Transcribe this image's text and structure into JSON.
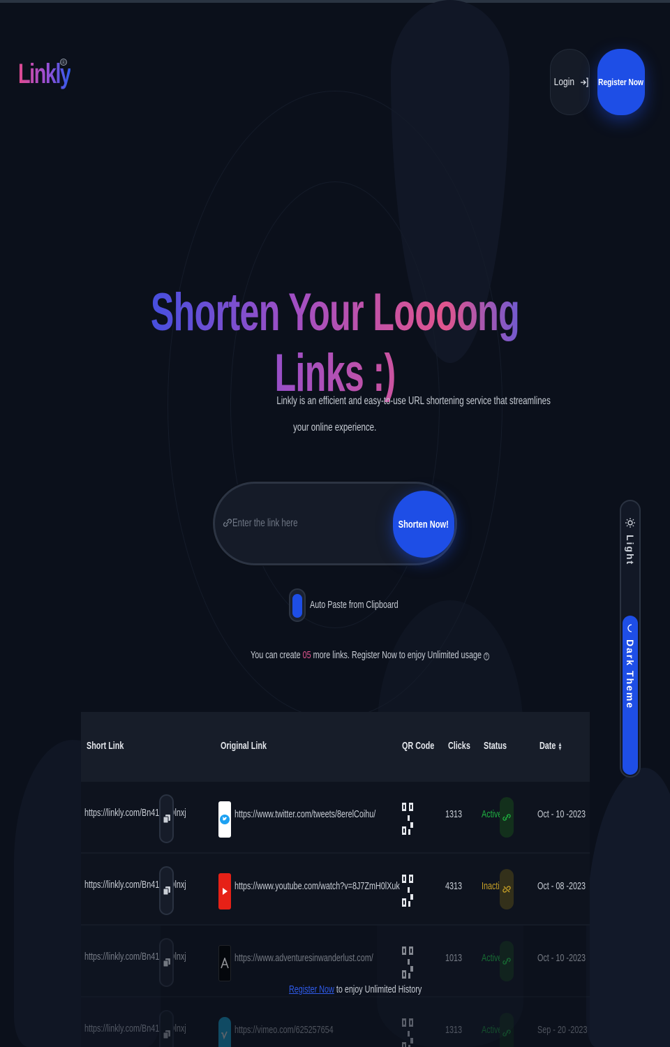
{
  "brand": {
    "name": "Linkly",
    "reg": "®"
  },
  "header": {
    "login_label": "Login",
    "register_label": "Register Now"
  },
  "hero": {
    "title": "Shorten Your Loooong Links :)",
    "subtitle_line1": "Linkly is an efficient and easy-to-use URL shortening service that streamlines",
    "subtitle_line2": "your online experience."
  },
  "shortener": {
    "placeholder": "Enter the link here",
    "button_label": "Shorten Now!",
    "autopaste_label": "Auto Paste from Clipboard",
    "autopaste_on": true
  },
  "limit": {
    "prefix": "You can create ",
    "count": "05",
    "suffix": " more links. Register Now to enjoy Unlimited usage"
  },
  "theme": {
    "light_label": "Light",
    "dark_label": "Dark Theme",
    "active": "dark"
  },
  "table": {
    "headers": {
      "short_link": "Short Link",
      "original_link": "Original Link",
      "qr_code": "QR Code",
      "clicks": "Clicks",
      "status": "Status",
      "date": "Date"
    },
    "rows": [
      {
        "short": "https://linkly.com/Bn41aCOlnxj",
        "site_icon": "twitter-icon",
        "original": "https://www.twitter.com/tweets/8erelCoihu/",
        "clicks": "1313",
        "status": "Active",
        "date": "Oct - 10 -2023"
      },
      {
        "short": "https://linkly.com/Bn41aCOlnxj",
        "site_icon": "youtube-icon",
        "original": "https://www.youtube.com/watch?v=8J7ZmH0lXuk",
        "clicks": "4313",
        "status": "Inactive",
        "date": "Oct - 08 -2023"
      },
      {
        "short": "https://linkly.com/Bn41aCOlnxj",
        "site_icon": "adventures-icon",
        "original": "https://www.adventuresinwanderlust.com/",
        "clicks": "1013",
        "status": "Active",
        "date": "Oct - 10 -2023"
      },
      {
        "short": "https://linkly.com/Bn41aCOlnxj",
        "site_icon": "vimeo-icon",
        "original": "https://vimeo.com/625257654",
        "clicks": "1313",
        "status": "Active",
        "date": "Sep - 20 -2023"
      }
    ]
  },
  "register_hint": {
    "link_label": "Register Now",
    "text": " to enjoy Unlimited History"
  },
  "colors": {
    "background": "#0b101b",
    "accent": "#1e4ee6",
    "pink": "#e0558e",
    "active": "#1fb141",
    "inactive": "#c9a227"
  }
}
